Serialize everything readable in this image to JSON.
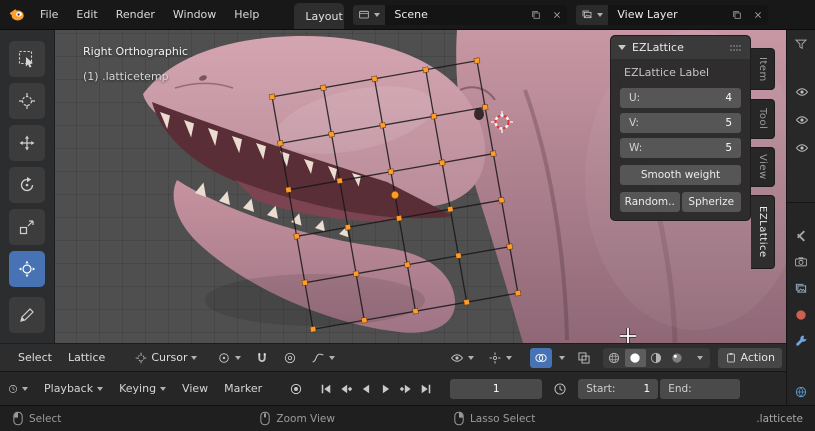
{
  "topbar": {
    "menus": [
      "File",
      "Edit",
      "Render",
      "Window",
      "Help"
    ],
    "workspace_tab": "Layout",
    "scene_name": "Scene",
    "view_layer_name": "View Layer"
  },
  "toolbar_tools": [
    "box-select",
    "cursor",
    "move",
    "rotate",
    "scale",
    "transform",
    "annotate"
  ],
  "viewport": {
    "view_label": "Right Orthographic",
    "object_label": "(1) .latticetemp"
  },
  "sidebar": {
    "tabs": [
      "Item",
      "Tool",
      "View",
      "EZLattice"
    ],
    "panel": {
      "title": "EZLattice",
      "label": "EZLattice Label",
      "fields": [
        {
          "label": "U:",
          "value": "4"
        },
        {
          "label": "V:",
          "value": "5"
        },
        {
          "label": "W:",
          "value": "5"
        }
      ],
      "smooth_button": "Smooth weight",
      "random_button": "Random..",
      "spherize_button": "Spherize"
    }
  },
  "viewport_header": {
    "select_menu": "Select",
    "lattice_menu": "Lattice",
    "pivot": "Cursor",
    "action": "Action"
  },
  "timeline": {
    "menus": [
      "Playback",
      "Keying",
      "View",
      "Marker"
    ],
    "current_frame": "1",
    "start_label": "Start:",
    "start_value": "1",
    "end_label": "End:"
  },
  "statusbar": {
    "hints": [
      {
        "label": "Select"
      },
      {
        "label": "Zoom View"
      },
      {
        "label": "Lasso Select"
      }
    ],
    "object_name": ".latticete"
  },
  "colors": {
    "accent": "#4772b3",
    "lattice_orange": "#ff9b2d",
    "model_pink": "#c795a1",
    "teeth": "#eadcd0"
  }
}
